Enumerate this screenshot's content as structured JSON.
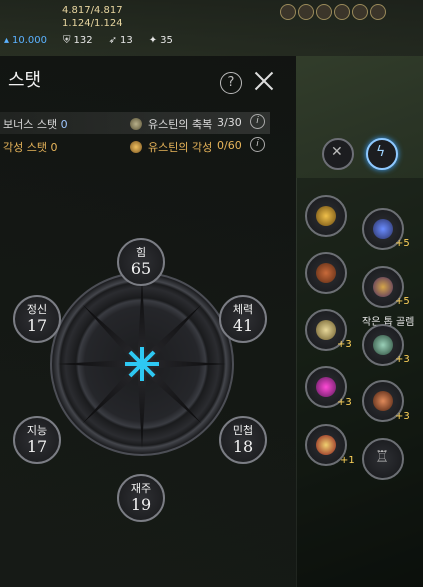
{
  "hud": {
    "hp": "4.817/4.817",
    "mp": "1.124/1.124",
    "gold": "10.000",
    "stat_a": "132",
    "stat_b": "13",
    "stat_c": "35"
  },
  "panel": {
    "title": "스탯",
    "help_label": "?",
    "bonus_label": "보너스 스탯",
    "bonus_value": "0",
    "awaken_label": "각성 스탯",
    "awaken_value": "0",
    "blessing_label": "유스틴의 축복",
    "blessing_value": "3/30",
    "awakening_label": "유스틴의 각성",
    "awakening_value": "0/60",
    "info_icon": "i"
  },
  "stats": [
    {
      "name": "힘",
      "value": "65"
    },
    {
      "name": "체력",
      "value": "41"
    },
    {
      "name": "민첩",
      "value": "18"
    },
    {
      "name": "재주",
      "value": "19"
    },
    {
      "name": "지능",
      "value": "17"
    },
    {
      "name": "정신",
      "value": "17"
    }
  ],
  "equipment": {
    "tooltip": "작은 톱 골렘",
    "plus": [
      "+5",
      "+5",
      "+3",
      "+3",
      "+3",
      "+3",
      "+1"
    ]
  },
  "colors": {
    "accent": "#2ec8f2",
    "plus": "#ffd35a",
    "gold_text": "#e8b55a"
  }
}
